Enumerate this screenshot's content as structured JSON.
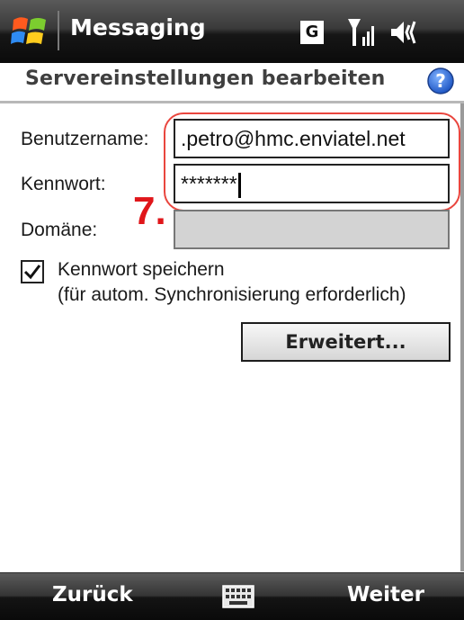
{
  "statusbar": {
    "app_title": "Messaging",
    "network_badge": "G",
    "icons": [
      "windows-start-icon",
      "signal-icon",
      "volume-icon"
    ]
  },
  "header": {
    "title": "Servereinstellungen bearbeiten",
    "help_icon": "help-icon"
  },
  "form": {
    "username": {
      "label": "Benutzername:",
      "value": ".petro@hmc.enviatel.net"
    },
    "password": {
      "label": "Kennwort:",
      "value": "*******"
    },
    "domain": {
      "label": "Domäne:",
      "value": ""
    },
    "save_password": {
      "checked": true,
      "line1": "Kennwort speichern",
      "line2": "(für autom. Synchronisierung erforderlich)"
    },
    "advanced_button": "Erweitert..."
  },
  "annotation": {
    "step": "7.",
    "color": "#e0161a"
  },
  "softkeys": {
    "left": "Zurück",
    "right": "Weiter",
    "center_icon": "keyboard-icon"
  },
  "colors": {
    "highlight": "#e9463e",
    "help_blue": "#1e63d0"
  }
}
